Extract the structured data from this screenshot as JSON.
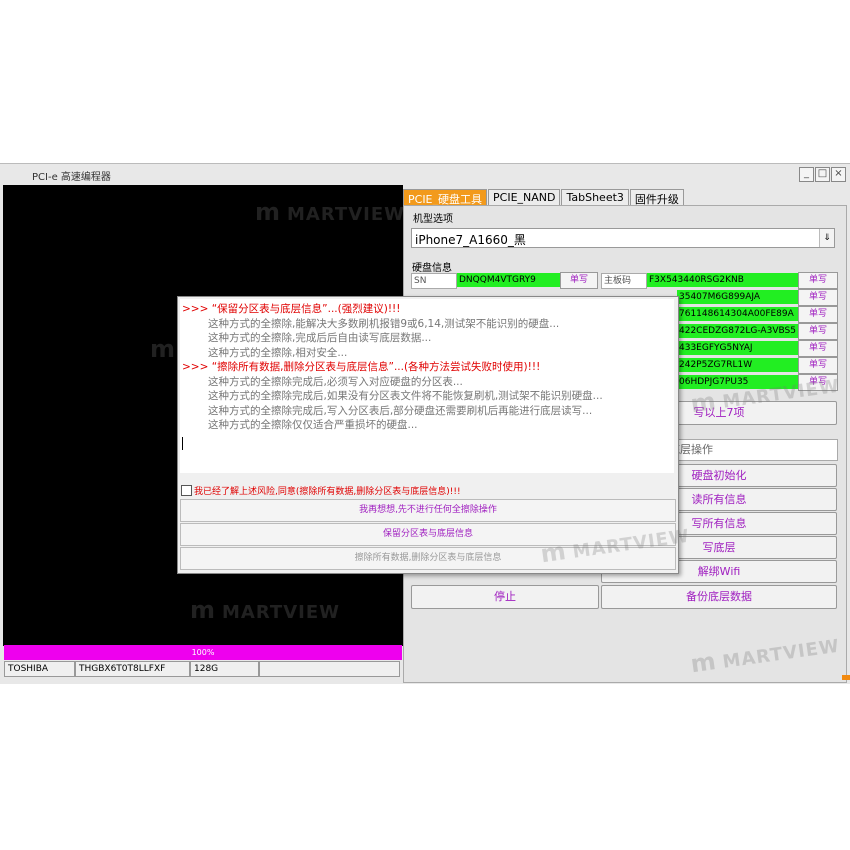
{
  "window": {
    "title": "PCI-e 高速编程器",
    "controls": [
      "_",
      "□",
      "×"
    ]
  },
  "progress": {
    "label": "100%",
    "percent": 100
  },
  "status": [
    "TOSHIBA",
    "THGBX6T0T8LLFXF",
    "128G",
    ""
  ],
  "tabs": [
    "PCIE_硬盘工具",
    "PCIE_NAND",
    "TabSheet3",
    "固件升级"
  ],
  "model": {
    "label": "机型选项",
    "selected": "iPhone7_A1660_黑",
    "arrow": "⇓"
  },
  "disk_info": {
    "label": "硬盘信息",
    "sn_label": "SN",
    "sn_value": "DNQQM4VTGRY9",
    "board_label": "主板码",
    "board_value": "F3X543440RSG2KNB",
    "write_label": "单写",
    "rows": [
      "35407M6G899AJA",
      "761148614304A00FE89A",
      "422CEDZG872LG-A3VBS5",
      "433EGFYG5NYAJ",
      "242P5ZG7RL1W",
      "06HDPJG7PU35"
    ]
  },
  "write7": "写以上7项",
  "layer_ops": {
    "label": "底层操作",
    "buttons": [
      "硬盘初始化",
      "读所有信息",
      "写所有信息",
      "写底层",
      "解绑Wifi"
    ]
  },
  "stop_button": "停止",
  "backup_button": "备份底层数据",
  "dialog": {
    "lines": [
      {
        "cls": "red",
        "text": ">>> “保留分区表与底层信息”...(强烈建议)!!!"
      },
      {
        "cls": "gray",
        "text": "这种方式的全擦除,能解决大多数刷机报错9或6,14,测试架不能识别的硬盘..."
      },
      {
        "cls": "gray",
        "text": "这种方式的全擦除,完成后后自由读写底层数据..."
      },
      {
        "cls": "gray",
        "text": "这种方式的全擦除,相对安全..."
      },
      {
        "cls": "red",
        "text": ">>> “擦除所有数据,删除分区表与底层信息”...(各种方法尝试失败时使用)!!!"
      },
      {
        "cls": "gray",
        "text": "这种方式的全擦除完成后,必须写入对应硬盘的分区表..."
      },
      {
        "cls": "gray",
        "text": "这种方式的全擦除完成后,如果没有分区表文件将不能恢复刷机,测试架不能识别硬盘..."
      },
      {
        "cls": "gray",
        "text": "这种方式的全擦除完成后,写入分区表后,部分硬盘还需要刷机后再能进行底层读写..."
      },
      {
        "cls": "gray",
        "text": "这种方式的全擦除仅仅适合严重损坏的硬盘..."
      }
    ],
    "checkbox_label": "我已经了解上述风险,同意(擦除所有数据,删除分区表与底层信息)!!!",
    "btn_cancel": "我再想想,先不进行任何全擦除操作",
    "btn_keep": "保留分区表与底层信息",
    "btn_erase_all": "擦除所有数据,删除分区表与底层信息"
  },
  "watermark": "MARTVIEW",
  "colors": {
    "accent": "#f29a1c",
    "progress": "#ee00ee",
    "info_green": "#22ee22",
    "button_text": "#a020c0",
    "warning_red": "#e00000"
  }
}
